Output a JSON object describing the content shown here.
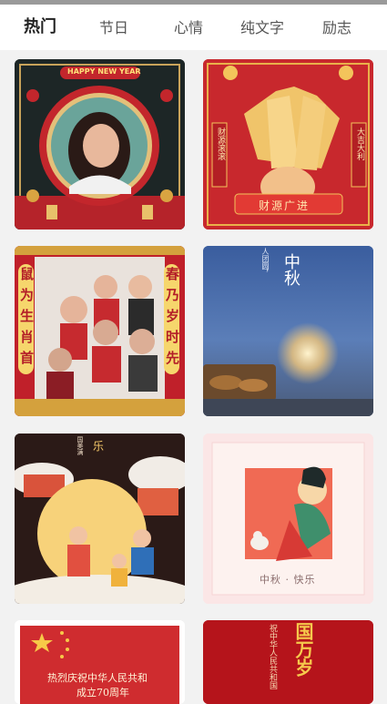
{
  "tabs": [
    {
      "label": "热门",
      "active": true
    },
    {
      "label": "节日",
      "active": false
    },
    {
      "label": "心情",
      "active": false
    },
    {
      "label": "纯文字",
      "active": false
    },
    {
      "label": "励志",
      "active": false
    }
  ],
  "cards": {
    "c1": {
      "banner": "HAPPY NEW YEAR"
    },
    "c2": {
      "title": "财源广进",
      "left_tag": "财源滚滚",
      "right_tag": "大吉大利"
    },
    "c3": {
      "left_text": "鼠为生肖首",
      "right_text": "春乃岁时先"
    },
    "c4": {
      "title": "中秋",
      "small_text": "人团圆，"
    },
    "c5": {
      "title": "乐",
      "small_text": "国美满"
    },
    "c6": {
      "caption": "中秋 · 快乐"
    },
    "c7": {
      "line1": "热烈庆祝中华人民共和",
      "line2": "成立70周年"
    },
    "c8": {
      "title": "国万岁",
      "small_text": "祝中华人民共和国"
    }
  },
  "colors": {
    "accent": "#222222",
    "tab_inactive": "#555555",
    "background": "#f2f2f2"
  }
}
